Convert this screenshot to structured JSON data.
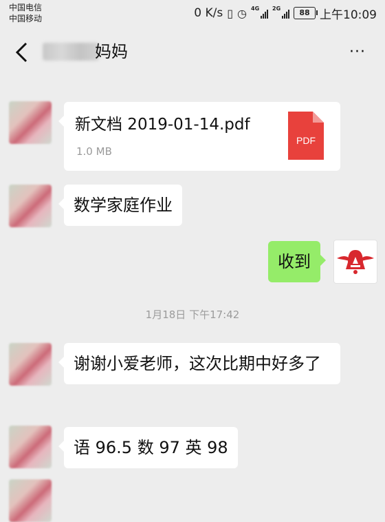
{
  "status_bar": {
    "carrier1": "中国电信",
    "carrier2": "中国移动",
    "speed": "0 K/s",
    "signal1_label": "4G",
    "signal2_label": "2G",
    "battery": "88",
    "time": "上午10:09"
  },
  "header": {
    "title": "妈妈",
    "more": "···"
  },
  "messages": [
    {
      "file_name": "新文档 2019-01-14.pdf",
      "file_size": "1.0 MB",
      "file_badge": "PDF"
    },
    {
      "text": "数学家庭作业"
    },
    {
      "text": "收到"
    },
    {
      "text": "谢谢小爱老师，这次比期中好多了"
    },
    {
      "text": "语 96.5 数 97 英 98"
    }
  ],
  "timestamp": "1月18日 下午17:42",
  "colors": {
    "background": "#ededed",
    "sent_bubble": "#95ec69",
    "received_bubble": "#ffffff",
    "pdf_red": "#e8413c"
  }
}
